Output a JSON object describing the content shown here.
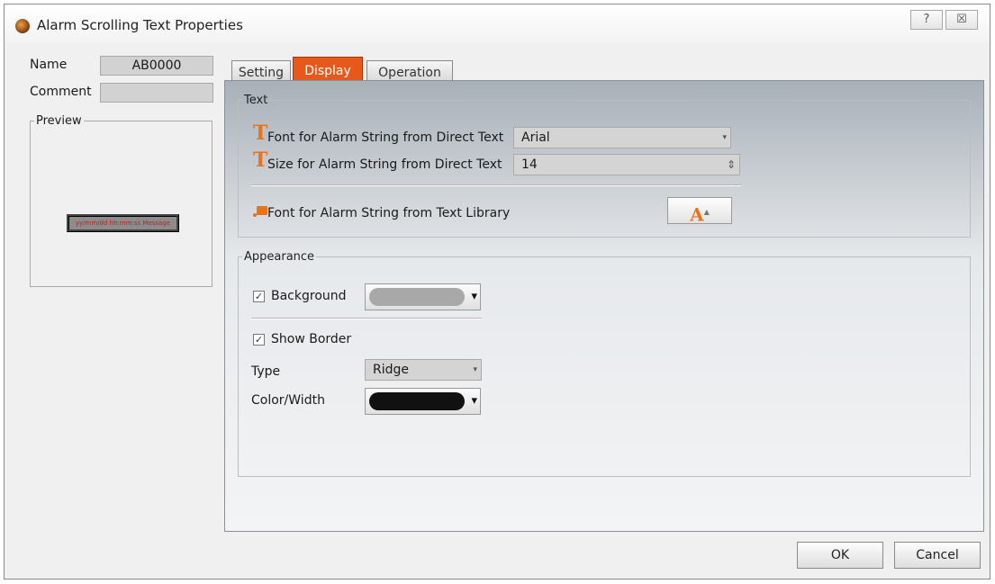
{
  "window": {
    "title": "Alarm Scrolling Text Properties",
    "help_glyph": "?",
    "close_glyph": "☒"
  },
  "left": {
    "name_label": "Name",
    "name_value": "AB0000",
    "comment_label": "Comment",
    "comment_value": "",
    "preview_label": "Preview",
    "preview_text": "yy/mm/dd hh:mm:ss Message"
  },
  "tabs": [
    {
      "label": "Setting",
      "active": false
    },
    {
      "label": "Display",
      "active": true
    },
    {
      "label": "Operation",
      "active": false
    }
  ],
  "text_group": {
    "legend": "Text",
    "font_direct_label": "Font for Alarm String from Direct Text",
    "font_direct_value": "Arial",
    "size_direct_label": "Size for Alarm String from Direct Text",
    "size_direct_value": "14",
    "font_library_label": "Font for Alarm String from Text Library",
    "t_glyph": "T",
    "font_button_glyph": "A"
  },
  "appearance": {
    "legend": "Appearance",
    "background_label": "Background",
    "background_checked": true,
    "background_color": "#a8a8a8",
    "show_border_label": "Show Border",
    "show_border_checked": true,
    "type_label": "Type",
    "type_value": "Ridge",
    "color_width_label": "Color/Width",
    "border_color": "#111111",
    "check_glyph": "✓",
    "dropdown_glyph": "▾",
    "spin_glyph": "⇕"
  },
  "buttons": {
    "ok": "OK",
    "cancel": "Cancel"
  },
  "colors": {
    "accent_tab": "#e8581a",
    "icon_orange": "#e8741a"
  }
}
